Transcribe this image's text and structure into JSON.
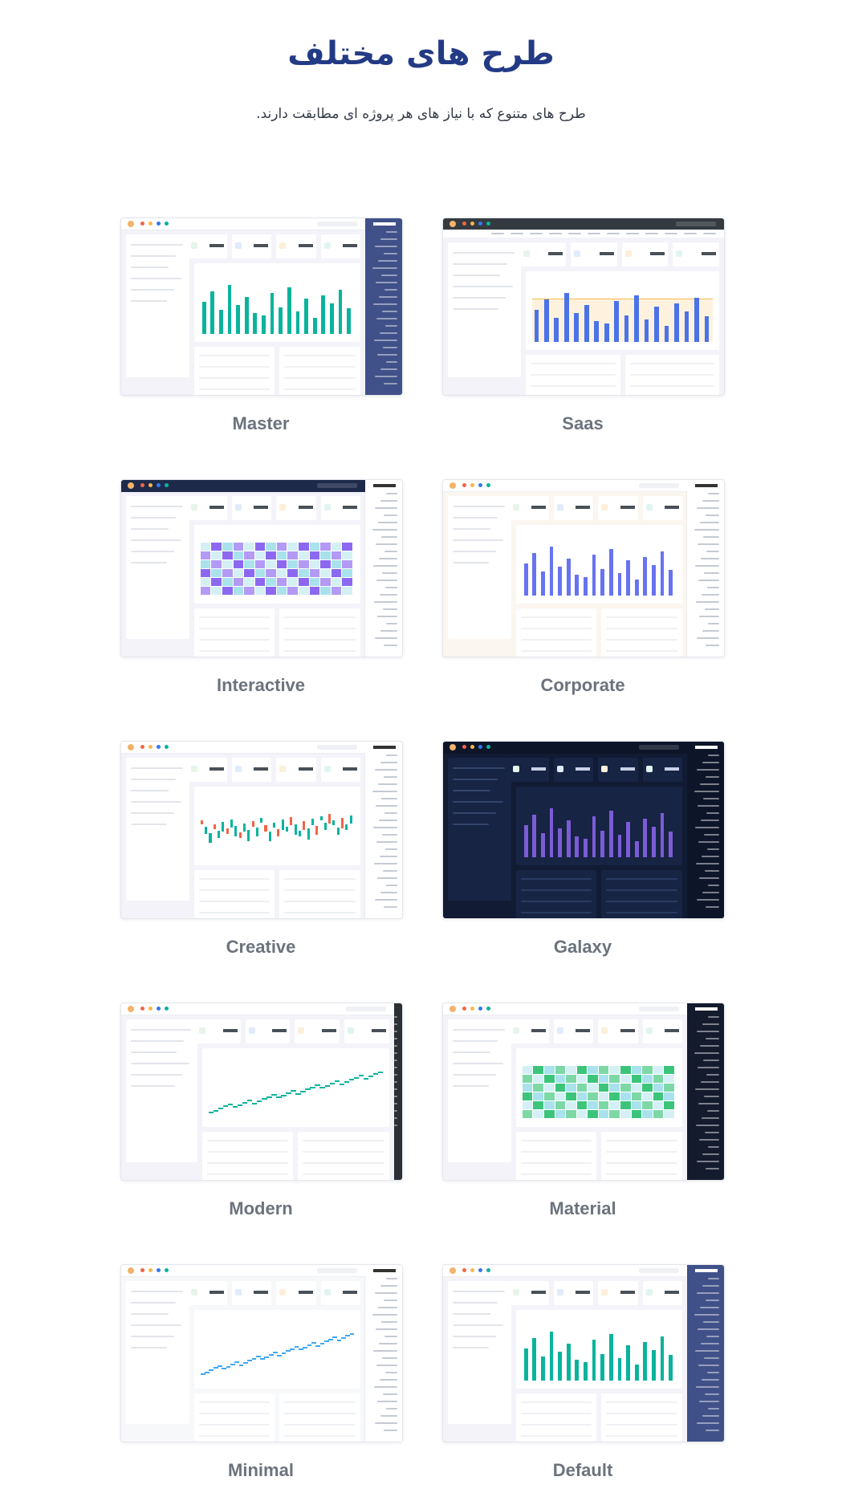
{
  "header": {
    "title": "طرح های مختلف",
    "subtitle": "طرح های متنوع که با نیاز های هر پروژه ای مطابقت دارند."
  },
  "layouts": [
    {
      "name": "Master",
      "theme": {
        "sidebar": "#405189",
        "topbar": "#ffffff",
        "body": "#f3f3f9",
        "card": "#ffffff",
        "chart": "#0ab39c",
        "chart_type": "bars"
      }
    },
    {
      "name": "Saas",
      "theme": {
        "sidebar": "none",
        "topbar": "#343a40",
        "body": "#f3f3f9",
        "card": "#ffffff",
        "chart": "#4b73e8",
        "chart_type": "area-bars"
      }
    },
    {
      "name": "Interactive",
      "theme": {
        "sidebar": "#ffffff",
        "topbar": "#1e2a4a",
        "body": "#f3f3f9",
        "card": "#ffffff",
        "chart": "#8c68f0",
        "chart_type": "heatmap"
      }
    },
    {
      "name": "Corporate",
      "theme": {
        "sidebar": "#ffffff",
        "topbar": "#ffffff",
        "body": "#fbf6ef",
        "card": "#ffffff",
        "chart": "#6773f1",
        "chart_type": "bars"
      }
    },
    {
      "name": "Creative",
      "theme": {
        "sidebar": "#ffffff",
        "topbar": "#ffffff",
        "body": "#f3f3f9",
        "card": "#ffffff",
        "chart": "#f06548",
        "chart_type": "candles"
      }
    },
    {
      "name": "Galaxy",
      "theme": {
        "sidebar": "#0d1629",
        "topbar": "#0d1629",
        "body": "#111b33",
        "card": "#172444",
        "chart": "#7c5cd6",
        "chart_type": "bars"
      }
    },
    {
      "name": "Modern",
      "theme": {
        "sidebar": "#2b3035",
        "topbar": "#ffffff",
        "body": "#f3f3f9",
        "card": "#ffffff",
        "chart": "#0ab39c",
        "chart_type": "line"
      }
    },
    {
      "name": "Material",
      "theme": {
        "sidebar": "#141b2d",
        "topbar": "#ffffff",
        "body": "#f3f3f9",
        "card": "#ffffff",
        "chart": "#3cc57a",
        "chart_type": "heatmap"
      }
    },
    {
      "name": "Minimal",
      "theme": {
        "sidebar": "#ffffff",
        "topbar": "#ffffff",
        "body": "#f7f8fa",
        "card": "#ffffff",
        "chart": "#3ea7f0",
        "chart_type": "line"
      }
    },
    {
      "name": "Default",
      "theme": {
        "sidebar": "#405189",
        "topbar": "#ffffff",
        "body": "#f3f3f9",
        "card": "#ffffff",
        "chart": "#0ab39c",
        "chart_type": "bars"
      }
    }
  ]
}
